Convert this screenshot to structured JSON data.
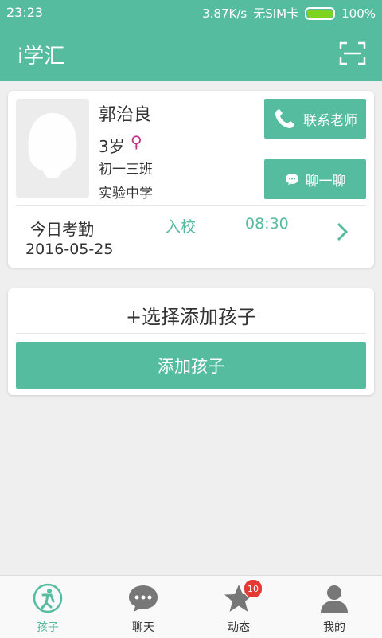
{
  "status_bar": {
    "time": "23:23",
    "speed": "3.87K/s",
    "sim": "无SIM卡",
    "battery": "100%"
  },
  "app_bar": {
    "title": "i学汇",
    "scan_icon": "scan-icon"
  },
  "child": {
    "name": "郭治良",
    "age": "3岁",
    "gender_symbol": "♀",
    "class": "初一三班",
    "school": "实验中学",
    "contact_teacher_label": "联系老师",
    "chat_label": "聊一聊",
    "attendance": {
      "label": "今日考勤",
      "date": "2016-05-25",
      "status": "入校",
      "time": "08:30"
    }
  },
  "add_child": {
    "title": "+选择添加孩子",
    "button_label": "添加孩子"
  },
  "tabs": [
    {
      "label": "孩子",
      "icon": "child-icon",
      "active": true
    },
    {
      "label": "聊天",
      "icon": "chat-icon",
      "active": false
    },
    {
      "label": "动态",
      "icon": "star-icon",
      "active": false,
      "badge": "10"
    },
    {
      "label": "我的",
      "icon": "person-icon",
      "active": false
    }
  ],
  "colors": {
    "accent": "#55bc9f",
    "gender": "#c0308a",
    "badge": "#e53935"
  }
}
